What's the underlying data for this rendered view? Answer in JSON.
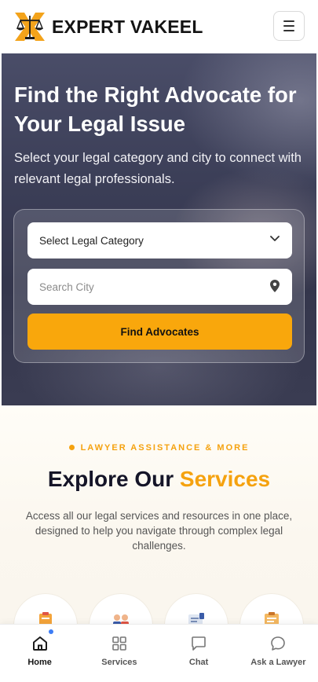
{
  "header": {
    "brand_name": "EXPERT VAKEEL",
    "logo_icon": "scales-of-justice-icon",
    "menu_icon": "hamburger-menu-icon"
  },
  "hero": {
    "title": "Find the Right Advocate for Your Legal Issue",
    "subtitle": "Select your legal category and city to connect with relevant legal professionals.",
    "category_select": {
      "selected": "Select Legal Category",
      "icon": "chevron-down-icon"
    },
    "city_input": {
      "placeholder": "Search City",
      "value": "",
      "icon": "map-pin-icon"
    },
    "find_button_label": "Find Advocates"
  },
  "services": {
    "eyebrow": "LAWYER ASSISTANCE & MORE",
    "title_main": "Explore Our ",
    "title_accent": "Services",
    "description": "Access all our legal services and resources in one place, designed to help you navigate through complex legal challenges.",
    "icons": [
      "clipboard-icon",
      "consultation-icon",
      "document-form-icon",
      "checklist-icon"
    ]
  },
  "bottom_nav": {
    "items": [
      {
        "label": "Home",
        "icon": "home-icon",
        "active": true
      },
      {
        "label": "Services",
        "icon": "grid-icon",
        "active": false
      },
      {
        "label": "Chat",
        "icon": "chat-square-icon",
        "active": false
      },
      {
        "label": "Ask a Lawyer",
        "icon": "chat-bubble-icon",
        "active": false
      }
    ]
  },
  "colors": {
    "accent": "#F9A70C",
    "dark_text": "#151528",
    "notification_dot": "#3D7DF5"
  }
}
